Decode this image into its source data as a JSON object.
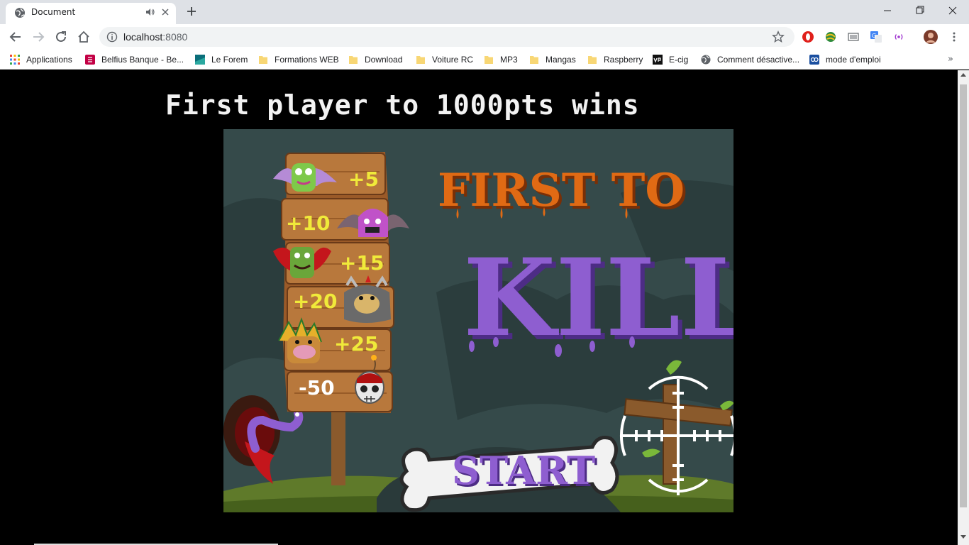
{
  "browser": {
    "tab_title": "Document",
    "url_host": "localhost",
    "url_port": ":8080",
    "new_tab_label": "+"
  },
  "bookmarks": [
    {
      "label": "Applications",
      "icon": "apps-grid-icon"
    },
    {
      "label": "Belfius Banque - Be...",
      "icon": "belfius-icon"
    },
    {
      "label": "Le Forem",
      "icon": "forem-icon"
    },
    {
      "label": "Formations WEB",
      "icon": "folder-icon"
    },
    {
      "label": "Download",
      "icon": "folder-icon"
    },
    {
      "label": "Voiture RC",
      "icon": "folder-icon"
    },
    {
      "label": "MP3",
      "icon": "folder-icon"
    },
    {
      "label": "Mangas",
      "icon": "folder-icon"
    },
    {
      "label": "Raspberry",
      "icon": "folder-icon"
    },
    {
      "label": "E-cig",
      "icon": "vap-icon"
    },
    {
      "label": "Comment désactive...",
      "icon": "globe-icon"
    },
    {
      "label": "mode d'emploi",
      "icon": "manual-icon"
    }
  ],
  "bookmarks_more": "»",
  "page": {
    "headline": "First player to 1000pts wins"
  },
  "game": {
    "title_line1": "FIRST  TO",
    "title_line2": "KILL",
    "start_label": "START",
    "scores": [
      {
        "label": "+5",
        "creature": "green-bat-monster"
      },
      {
        "label": "+10",
        "creature": "purple-bat-monster"
      },
      {
        "label": "+15",
        "creature": "red-winged-monster"
      },
      {
        "label": "+20",
        "creature": "grey-horned-monster"
      },
      {
        "label": "+25",
        "creature": "pink-feathered-monster"
      },
      {
        "label": "-50",
        "creature": "skull-bomb"
      }
    ],
    "colors": {
      "background": "#354a4a",
      "title_orange": "#e06a14",
      "title_purple": "#8e5ed0",
      "score_yellow": "#f0ea3a",
      "wood": "#9a5a28",
      "grass": "#5f7a2a"
    }
  }
}
